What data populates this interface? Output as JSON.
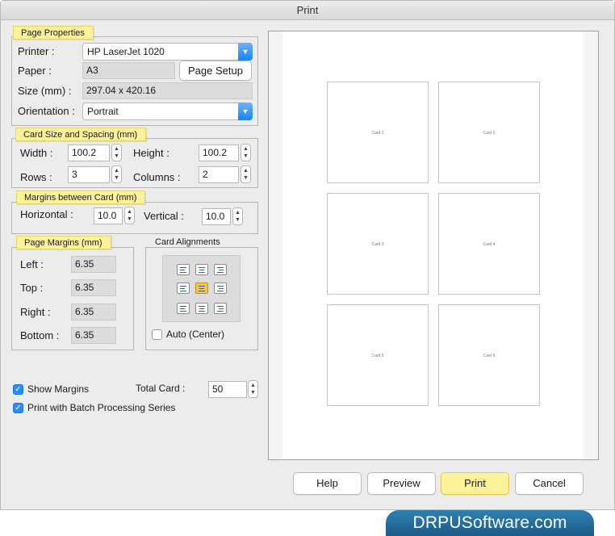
{
  "window": {
    "title": "Print"
  },
  "page_properties": {
    "heading": "Page Properties",
    "printer_label": "Printer :",
    "printer_value": "HP LaserJet 1020",
    "paper_label": "Paper :",
    "paper_value": "A3",
    "page_setup_button": "Page Setup",
    "size_label": "Size (mm) :",
    "size_value": "297.04 x 420.16",
    "orientation_label": "Orientation :",
    "orientation_value": "Portrait"
  },
  "card_size": {
    "heading": "Card Size and Spacing (mm)",
    "width_label": "Width :",
    "width_value": "100.2",
    "height_label": "Height :",
    "height_value": "100.2",
    "rows_label": "Rows :",
    "rows_value": "3",
    "columns_label": "Columns :",
    "columns_value": "2"
  },
  "card_margins": {
    "heading": "Margins between Card (mm)",
    "horizontal_label": "Horizontal :",
    "horizontal_value": "10.0",
    "vertical_label": "Vertical :",
    "vertical_value": "10.0"
  },
  "page_margins": {
    "heading": "Page Margins (mm)",
    "left_label": "Left :",
    "left_value": "6.35",
    "top_label": "Top :",
    "top_value": "6.35",
    "right_label": "Right :",
    "right_value": "6.35",
    "bottom_label": "Bottom :",
    "bottom_value": "6.35"
  },
  "card_alignments": {
    "heading": "Card Alignments",
    "selected": "middle-center",
    "auto_label": "Auto (Center)",
    "auto_checked": false
  },
  "options": {
    "show_margins_label": "Show Margins",
    "show_margins_checked": true,
    "batch_label": "Print with Batch Processing Series",
    "batch_checked": true,
    "total_card_label": "Total Card :",
    "total_card_value": "50"
  },
  "preview": {
    "cards": [
      "Card 1",
      "Card 2",
      "Card 3",
      "Card 4",
      "Card 5",
      "Card 6"
    ]
  },
  "buttons": {
    "help": "Help",
    "preview": "Preview",
    "print": "Print",
    "cancel": "Cancel"
  },
  "banner": "DRPUSoftware.com",
  "colors": {
    "accent_blue": "#1a82f7",
    "tag_yellow": "#fdf29a",
    "banner_blue": "#1c5c8a"
  }
}
